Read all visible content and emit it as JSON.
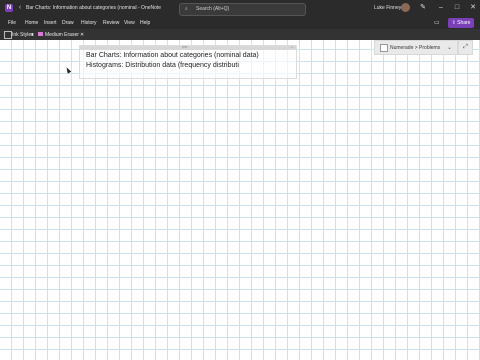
{
  "window": {
    "title": "Bar Charts: Information about categories (nominal - OneNote",
    "search_placeholder": "Search (Alt+Q)",
    "user_name": "Luke Finney",
    "share_label": "Share"
  },
  "menu": {
    "items": [
      "File",
      "Home",
      "Insert",
      "Draw",
      "History",
      "Review",
      "View",
      "Help"
    ]
  },
  "ribbon": {
    "ink_styles": "Ink Styles",
    "eraser": "Medium Eraser"
  },
  "nav": {
    "breadcrumb": "Numerade > Problems"
  },
  "note": {
    "lines": [
      "Bar Charts: Information about categories (nominal data)",
      "Histograms: Distribution data (frequency distributi"
    ]
  },
  "icons": {
    "app": "onenote-icon",
    "search": "search-icon",
    "share": "share-icon"
  },
  "colors": {
    "accent": "#7b3fb7",
    "titlebar": "#2b2b2b",
    "grid": "#cfe3ef"
  }
}
